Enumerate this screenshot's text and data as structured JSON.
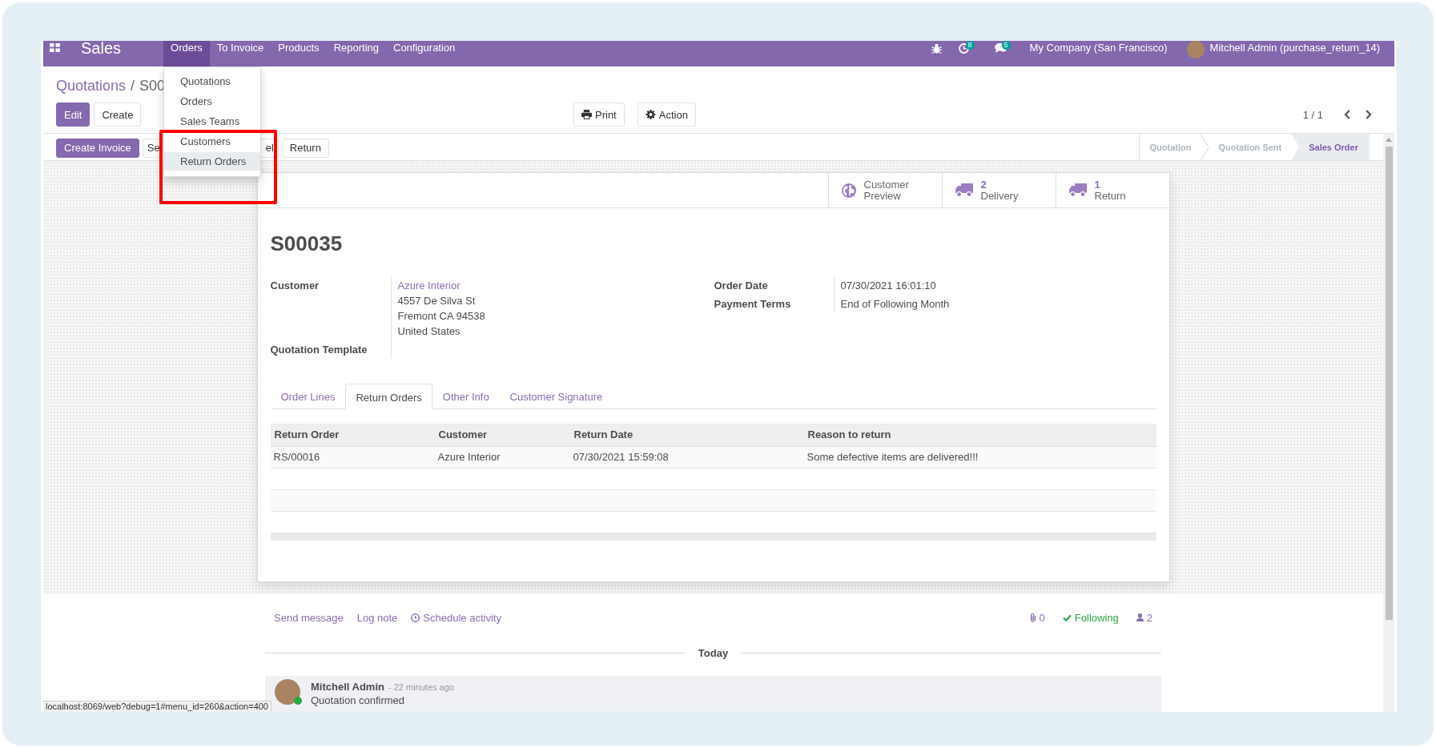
{
  "navbar": {
    "app_name": "Sales",
    "menus": [
      {
        "label": "Orders",
        "selected": true
      },
      {
        "label": "To Invoice",
        "selected": false
      },
      {
        "label": "Products",
        "selected": false
      },
      {
        "label": "Reporting",
        "selected": false
      },
      {
        "label": "Configuration",
        "selected": false
      }
    ],
    "activity_count": "8",
    "message_count": "5",
    "company": "My Company (San Francisco)",
    "user": "Mitchell Admin (purchase_return_14)"
  },
  "orders_menu": {
    "items": [
      {
        "label": "Quotations",
        "selected": false
      },
      {
        "label": "Orders",
        "selected": false
      },
      {
        "label": "Sales Teams",
        "selected": false
      },
      {
        "label": "Customers",
        "selected": false
      },
      {
        "label": "Return Orders",
        "selected": true
      }
    ]
  },
  "breadcrumb": {
    "parent": "Quotations",
    "separator": "/",
    "current": "S00"
  },
  "main_buttons": [
    {
      "label": "Edit",
      "kind": "primary"
    },
    {
      "label": "Create",
      "kind": "secondary"
    }
  ],
  "menu_buttons": [
    {
      "label": "Print"
    },
    {
      "label": "Action"
    }
  ],
  "pager": "1 / 1",
  "header_buttons": [
    {
      "label": "Create Invoice",
      "kind": "primary"
    },
    {
      "label": "Se",
      "kind": "covered_start"
    },
    {
      "label": "el",
      "kind": "covered_end"
    },
    {
      "label": "Return",
      "kind": "secondary"
    }
  ],
  "statusbar": [
    {
      "label": "Quotation",
      "selected": false
    },
    {
      "label": "Quotation Sent",
      "selected": false
    },
    {
      "label": "Sales Order",
      "selected": true
    }
  ],
  "smart_buttons": [
    {
      "kind": "preview",
      "label": "Customer Preview"
    },
    {
      "kind": "stat",
      "count": "2",
      "label": "Delivery"
    },
    {
      "kind": "stat",
      "count": "1",
      "label": "Return"
    }
  ],
  "title": "S00035",
  "left_fields": [
    {
      "label": "Customer",
      "link": "Azure Interior",
      "lines": [
        "4557 De Silva St",
        "Fremont CA 94538",
        "United States"
      ]
    },
    {
      "label": "Quotation Template"
    }
  ],
  "right_fields": [
    {
      "label": "Order Date",
      "value": "07/30/2021 16:01:10"
    },
    {
      "label": "Payment Terms",
      "value": "End of Following Month"
    }
  ],
  "tabs": [
    {
      "label": "Order Lines",
      "selected": false
    },
    {
      "label": "Return Orders",
      "selected": true
    },
    {
      "label": "Other Info",
      "selected": false
    },
    {
      "label": "Customer Signature",
      "selected": false
    }
  ],
  "table": {
    "columns": [
      "Return Order",
      "Customer",
      "Return Date",
      "Reason to return"
    ],
    "rows": [
      [
        "RS/00016",
        "Azure Interior",
        "07/30/2021 15:59:08",
        "Some defective items are delivered!!!"
      ]
    ]
  },
  "chatter": {
    "actions": [
      {
        "kind": "text",
        "label": "Send message"
      },
      {
        "kind": "text",
        "label": "Log note"
      },
      {
        "kind": "activity",
        "label": "Schedule activity"
      }
    ],
    "attachments": "0",
    "follow_label": "Following",
    "followers": "2",
    "date_separator": "Today",
    "messages": [
      {
        "author": "Mitchell Admin",
        "time": "- 22 minutes ago",
        "body": "Quotation confirmed",
        "online": true
      }
    ]
  },
  "status_url": "localhost:8069/web?debug=1#menu_id=260&action=400"
}
